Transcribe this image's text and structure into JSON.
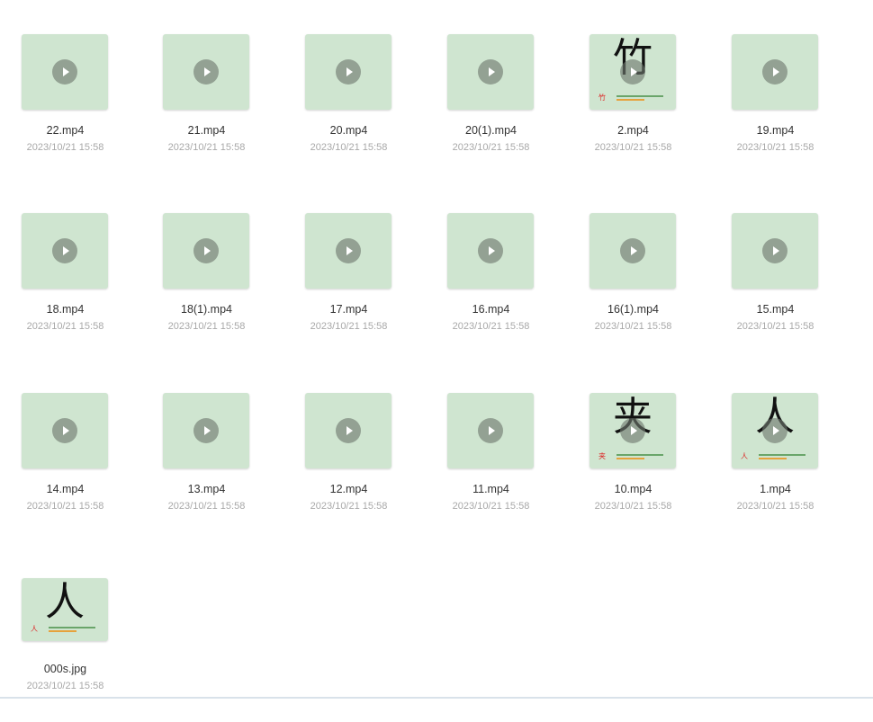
{
  "files": [
    {
      "name": "22.mp4",
      "date": "2023/10/21 15:58",
      "type": "video"
    },
    {
      "name": "21.mp4",
      "date": "2023/10/21 15:58",
      "type": "video"
    },
    {
      "name": "20.mp4",
      "date": "2023/10/21 15:58",
      "type": "video"
    },
    {
      "name": "20(1).mp4",
      "date": "2023/10/21 15:58",
      "type": "video"
    },
    {
      "name": "2.mp4",
      "date": "2023/10/21 15:58",
      "type": "video",
      "thumb_char": "竹",
      "thumb_small_char": "竹"
    },
    {
      "name": "19.mp4",
      "date": "2023/10/21 15:58",
      "type": "video"
    },
    {
      "name": "18.mp4",
      "date": "2023/10/21 15:58",
      "type": "video"
    },
    {
      "name": "18(1).mp4",
      "date": "2023/10/21 15:58",
      "type": "video"
    },
    {
      "name": "17.mp4",
      "date": "2023/10/21 15:58",
      "type": "video"
    },
    {
      "name": "16.mp4",
      "date": "2023/10/21 15:58",
      "type": "video"
    },
    {
      "name": "16(1).mp4",
      "date": "2023/10/21 15:58",
      "type": "video"
    },
    {
      "name": "15.mp4",
      "date": "2023/10/21 15:58",
      "type": "video"
    },
    {
      "name": "14.mp4",
      "date": "2023/10/21 15:58",
      "type": "video"
    },
    {
      "name": "13.mp4",
      "date": "2023/10/21 15:58",
      "type": "video"
    },
    {
      "name": "12.mp4",
      "date": "2023/10/21 15:58",
      "type": "video"
    },
    {
      "name": "11.mp4",
      "date": "2023/10/21 15:58",
      "type": "video"
    },
    {
      "name": "10.mp4",
      "date": "2023/10/21 15:58",
      "type": "video",
      "thumb_char": "夹",
      "thumb_small_char": "夹"
    },
    {
      "name": "1.mp4",
      "date": "2023/10/21 15:58",
      "type": "video",
      "thumb_char": "人",
      "thumb_small_char": "人"
    },
    {
      "name": "000s.jpg",
      "date": "2023/10/21 15:58",
      "type": "image",
      "thumb_char": "人",
      "thumb_small_char": "人"
    }
  ],
  "colors": {
    "thumb_bg": "#cfe5d0",
    "name_text": "#333333",
    "date_text": "#a8a8a8"
  },
  "icons": {
    "play": "play-icon"
  }
}
